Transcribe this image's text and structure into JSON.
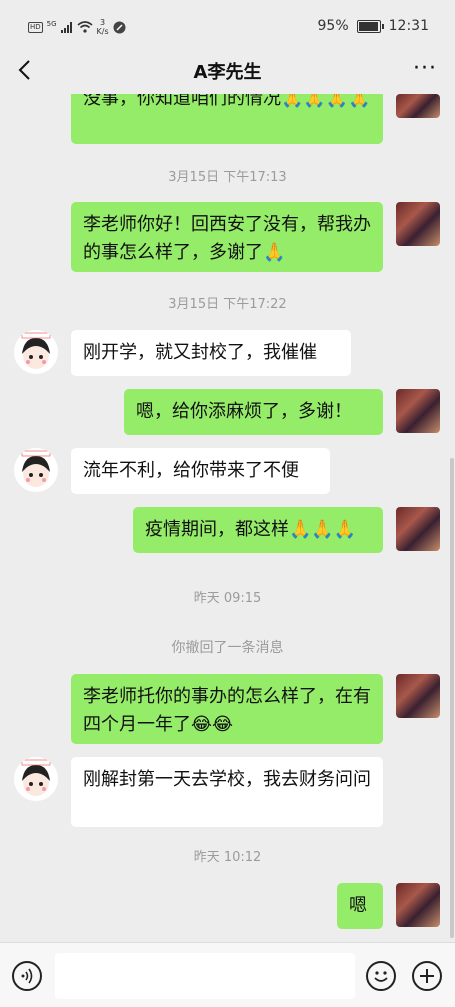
{
  "status_bar": {
    "hd": "HD",
    "network": "5G",
    "speed_value": "3",
    "speed_unit": "K/s",
    "battery": "95%",
    "time": "12:31"
  },
  "header": {
    "title": "A李先生"
  },
  "messages": [
    {
      "side": "self",
      "text": "没事，你知道咱们的情况🙏🙏🙏🙏"
    },
    {
      "type": "time",
      "text": "3月15日 下午17:13"
    },
    {
      "side": "self",
      "text": "李老师你好！回西安了没有，帮我办的事怎么样了，多谢了🙏"
    },
    {
      "type": "time",
      "text": "3月15日 下午17:22"
    },
    {
      "side": "other",
      "text": "刚开学，就又封校了，我催催"
    },
    {
      "side": "self",
      "text": "嗯，给你添麻烦了，多谢！"
    },
    {
      "side": "other",
      "text": "流年不利，给你带来了不便"
    },
    {
      "side": "self",
      "text": "疫情期间，都这样🙏🙏🙏"
    },
    {
      "type": "time",
      "text": "昨天 09:15"
    },
    {
      "type": "system",
      "text": "你撤回了一条消息"
    },
    {
      "side": "self",
      "text": "李老师托你的事办的怎么样了，在有四个月一年了😂😂"
    },
    {
      "side": "other",
      "text": "刚解封第一天去学校，我去财务问问"
    },
    {
      "type": "time",
      "text": "昨天 10:12"
    },
    {
      "side": "self",
      "text": "嗯"
    }
  ],
  "colors": {
    "self_bubble": "#95ec69",
    "other_bubble": "#ffffff",
    "background": "#ededed"
  },
  "icons": {
    "back": "chevron-left-icon",
    "more": "more-dots-icon",
    "voice": "voice-icon",
    "emoji": "emoji-icon",
    "plus": "plus-icon"
  }
}
